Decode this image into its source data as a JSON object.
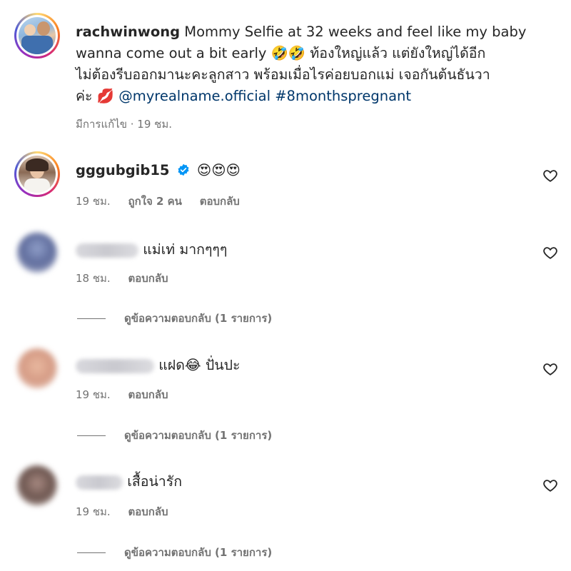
{
  "post": {
    "author": "rachwinwong",
    "caption_line1": "Mommy Selfie at 32 weeks and feel like my baby",
    "caption_line2_text": "wanna come out a bit early",
    "caption_line2_emoji": "🤣🤣",
    "caption_line2_thai": "ท้องใหญ่แล้ว แต่ยังใหญ่ได้อีก",
    "caption_line3": "ไม่ต้องรีบออกมานะคะลูกสาว พร้อมเมื่อไรค่อยบอกแม่ เจอกันต้นธันวา",
    "caption_line4_text": "ค่ะ",
    "caption_line4_emoji": "💋",
    "mention": "@myrealname.official",
    "hashtag": "#8monthspregnant",
    "meta": "มีการแก้ไข · 19 ชม."
  },
  "comments": [
    {
      "username": "gggubgib15",
      "verified": true,
      "text": "😍😍😍",
      "time": "19 ชม.",
      "likes": "ถูกใจ 2 คน",
      "reply_label": "ตอบกลับ"
    },
    {
      "username_blurred": true,
      "text": "แม่เท่ มากๆๆๆ",
      "time": "18 ชม.",
      "reply_label": "ตอบกลับ",
      "view_replies": "ดูข้อความตอบกลับ (1 รายการ)"
    },
    {
      "username_blurred": true,
      "text_before": "แฝด",
      "emoji": "😂",
      "text_after": "ปั่นปะ",
      "time": "19 ชม.",
      "reply_label": "ตอบกลับ",
      "view_replies": "ดูข้อความตอบกลับ (1 รายการ)"
    },
    {
      "username_blurred": true,
      "text": "เสื้อน่ารัก",
      "time": "19 ชม.",
      "reply_label": "ตอบกลับ",
      "view_replies": "ดูข้อความตอบกลับ (1 รายการ)"
    }
  ],
  "icons": {
    "heart": "heart-outline-icon",
    "verified": "verified-badge-icon"
  },
  "colors": {
    "text": "#262626",
    "secondary": "#737373",
    "link": "#00376b",
    "verified": "#0095f6"
  }
}
